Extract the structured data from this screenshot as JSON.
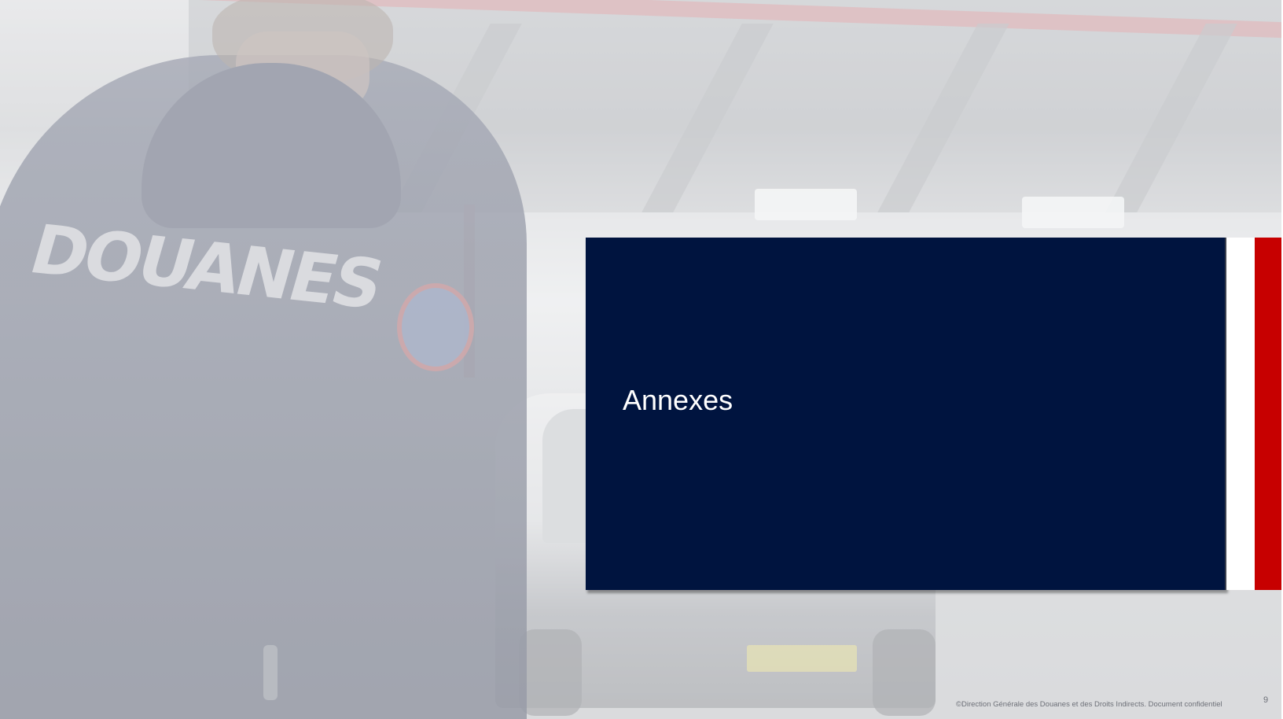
{
  "slide": {
    "title": "Annexes",
    "background_photo": {
      "jacket_lettering": "DOUANES"
    },
    "footer": {
      "copyright": "©Direction Générale des Douanes et des Droits Indirects. Document confidentiel",
      "page_number": "9"
    },
    "colors": {
      "panel_navy": "#00143f",
      "flag_white": "#ffffff",
      "flag_red": "#c70000"
    }
  }
}
